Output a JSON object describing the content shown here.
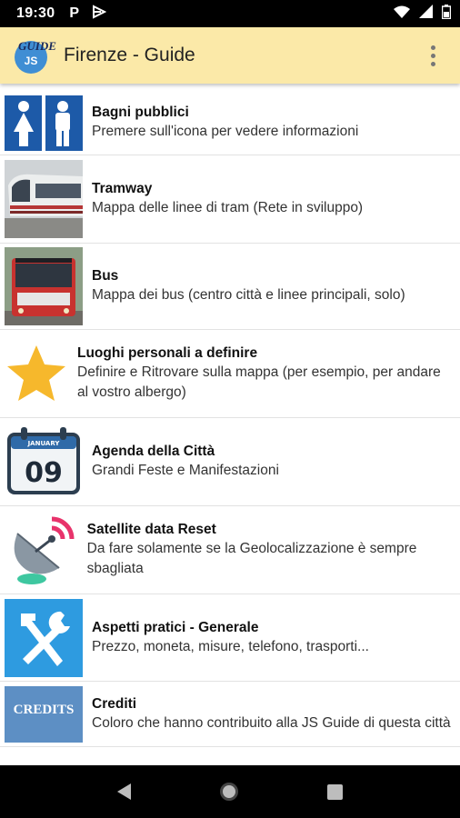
{
  "status_bar": {
    "time": "19:30",
    "icons": [
      "parking-p-icon",
      "notification-icon",
      "wifi-icon",
      "signal-icon",
      "battery-icon"
    ]
  },
  "app_bar": {
    "logo_text_top": "GUIDE",
    "logo_text_circle": "JS",
    "title": "Firenze - Guide",
    "overflow_icon": "more-vert-icon",
    "background_color": "#fbe9a8"
  },
  "items": [
    {
      "icon": "restroom-icon",
      "title": "Bagni pubblici",
      "subtitle": "Premere sull'icona per vedere informazioni"
    },
    {
      "icon": "tram-photo",
      "title": "Tramway",
      "subtitle": "Mappa delle linee di tram (Rete in sviluppo)"
    },
    {
      "icon": "bus-photo",
      "title": "Bus",
      "subtitle": "Mappa dei bus (centro città e linee principali, solo)"
    },
    {
      "icon": "star-icon",
      "title": "Luoghi personali a definire",
      "subtitle": "Definire e Ritrovare sulla mappa (per esempio, per andare al vostro albergo)"
    },
    {
      "icon": "calendar-icon",
      "title": "Agenda della Città",
      "subtitle": "Grandi Feste e Manifestazioni",
      "calendar_month": "JANUARY",
      "calendar_day": "09"
    },
    {
      "icon": "satellite-dish-icon",
      "title": "Satellite data Reset",
      "subtitle": "Da fare solamente se la Geolocalizzazione è sempre sbagliata"
    },
    {
      "icon": "tools-icon",
      "title": "Aspetti pratici - Generale",
      "subtitle": "Prezzo, moneta, misure, telefono, trasporti..."
    },
    {
      "icon": "credits-icon",
      "title": "Crediti",
      "subtitle": "Coloro che hanno contribuito alla JS Guide di questa città",
      "badge_text": "CREDITS"
    }
  ],
  "nav_bar": {
    "icons": [
      "back-icon",
      "home-icon",
      "recents-icon"
    ]
  }
}
